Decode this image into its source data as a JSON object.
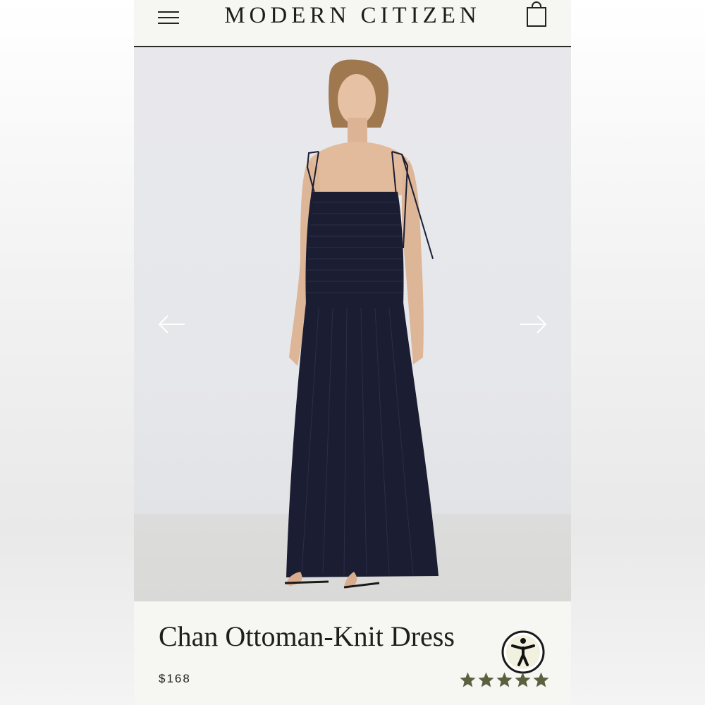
{
  "header": {
    "brand": "MODERN CITIZEN",
    "menu_icon": "hamburger-menu-icon",
    "bag_icon": "shopping-bag-icon"
  },
  "gallery": {
    "prev_icon": "arrow-left-icon",
    "next_icon": "arrow-right-icon"
  },
  "product": {
    "title": "Chan Ottoman-Knit Dress",
    "price": "$168",
    "rating": 5,
    "rating_max": 5
  },
  "accessibility": {
    "icon": "accessibility-icon"
  },
  "colors": {
    "background": "#f6f6f2",
    "text": "#1e1e1e",
    "star": "#5b6140",
    "dress": "#1b1d33"
  }
}
